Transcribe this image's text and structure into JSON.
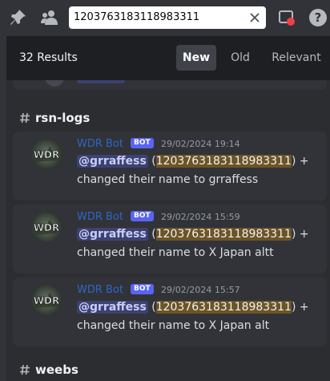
{
  "topbar": {
    "pin_icon": "pin-icon",
    "members_icon": "members-icon",
    "inbox_icon": "inbox-icon",
    "help_icon": "help-icon"
  },
  "search": {
    "value": "1203763183118983311",
    "clear_icon": "close-icon"
  },
  "results": {
    "count_label": "32 Results",
    "sort_tabs": [
      "New",
      "Old",
      "Relevant"
    ],
    "active_sort": "New"
  },
  "groups": [
    {
      "channel": "rsn-logs",
      "messages": [
        {
          "author": "WDR Bot",
          "badge": "BOT",
          "timestamp": "29/02/2024 19:14",
          "mention": "@grraffess",
          "open_paren": "(",
          "id_match": "1203763183118983311",
          "close_rest": ") +",
          "line2": "changed their name to grraffess"
        },
        {
          "author": "WDR Bot",
          "badge": "BOT",
          "timestamp": "29/02/2024 15:59",
          "mention": "@grraffess",
          "open_paren": "(",
          "id_match": "1203763183118983311",
          "close_rest": ") +",
          "line2": "changed their name to X Japan altt"
        },
        {
          "author": "WDR Bot",
          "badge": "BOT",
          "timestamp": "29/02/2024 15:57",
          "mention": "@grraffess",
          "open_paren": "(",
          "id_match": "1203763183118983311",
          "close_rest": ") +",
          "line2": "changed their name to X Japan alt"
        }
      ]
    },
    {
      "channel": "weebs",
      "messages": []
    }
  ],
  "colors": {
    "background": "#313338",
    "panel": "#2b2d31",
    "header": "#1e1f22",
    "author": "#2f66c4",
    "bot_badge": "#5865f2",
    "mention_bg": "#3c4270",
    "search_highlight": "#6c5426"
  }
}
